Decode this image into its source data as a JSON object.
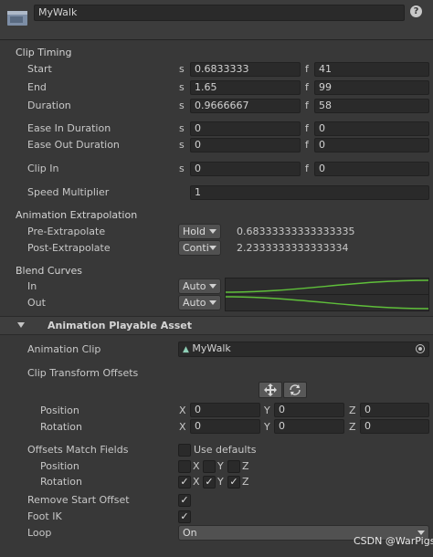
{
  "header": {
    "name": "MyWalk",
    "help_icon": "question-circle-icon"
  },
  "clip_timing": {
    "section": "Clip Timing",
    "start": {
      "label": "Start",
      "s_unit": "s",
      "s": "0.6833333",
      "f_unit": "f",
      "f": "41"
    },
    "end": {
      "label": "End",
      "s_unit": "s",
      "s": "1.65",
      "f_unit": "f",
      "f": "99"
    },
    "duration": {
      "label": "Duration",
      "s_unit": "s",
      "s": "0.9666667",
      "f_unit": "f",
      "f": "58"
    },
    "ease_in": {
      "label": "Ease In Duration",
      "s_unit": "s",
      "s": "0",
      "f_unit": "f",
      "f": "0"
    },
    "ease_out": {
      "label": "Ease Out Duration",
      "s_unit": "s",
      "s": "0",
      "f_unit": "f",
      "f": "0"
    },
    "clip_in": {
      "label": "Clip In",
      "s_unit": "s",
      "s": "0",
      "f_unit": "f",
      "f": "0"
    },
    "speed": {
      "label": "Speed Multiplier",
      "value": "1"
    }
  },
  "extrapolation": {
    "section": "Animation Extrapolation",
    "pre": {
      "label": "Pre-Extrapolate",
      "mode": "Hold",
      "value": "0.68333333333333335"
    },
    "post": {
      "label": "Post-Extrapolate",
      "mode": "Conti",
      "value": "2.2333333333333334"
    }
  },
  "blend": {
    "section": "Blend Curves",
    "in": {
      "label": "In",
      "mode": "Auto"
    },
    "out": {
      "label": "Out",
      "mode": "Auto"
    },
    "curve_color": "#5fbf3a"
  },
  "playable": {
    "section": "Animation Playable Asset",
    "clip_label": "Animation Clip",
    "clip_value": "MyWalk",
    "offsets_label": "Clip Transform Offsets",
    "position": {
      "label": "Position",
      "x_label": "X",
      "x": "0",
      "y_label": "Y",
      "y": "0",
      "z_label": "Z",
      "z": "0"
    },
    "rotation": {
      "label": "Rotation",
      "x_label": "X",
      "x": "0",
      "y_label": "Y",
      "y": "0",
      "z_label": "Z",
      "z": "0"
    },
    "match_label": "Offsets Match Fields",
    "use_defaults": "Use defaults",
    "match_position": {
      "label": "Position",
      "x": "X",
      "y": "Y",
      "z": "Z"
    },
    "match_rotation": {
      "label": "Rotation",
      "x": "X",
      "y": "Y",
      "z": "Z"
    },
    "remove_start": "Remove Start Offset",
    "foot_ik": "Foot IK",
    "loop_label": "Loop",
    "loop_value": "On"
  },
  "watermark": "CSDN @WarPigs"
}
